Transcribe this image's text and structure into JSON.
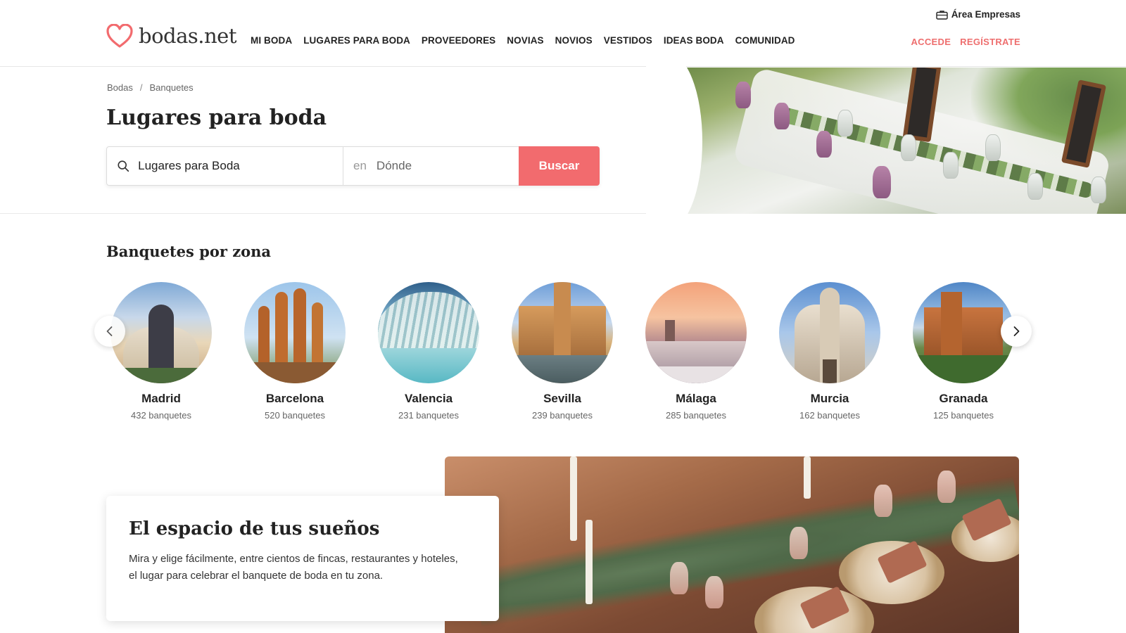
{
  "header": {
    "logo_text": "bodas.net",
    "area_empresas": "Área Empresas",
    "nav": [
      "MI BODA",
      "LUGARES PARA BODA",
      "PROVEEDORES",
      "NOVIAS",
      "NOVIOS",
      "VESTIDOS",
      "IDEAS BODA",
      "COMUNIDAD"
    ],
    "login": "ACCEDE",
    "register": "REGÍSTRATE"
  },
  "hero": {
    "breadcrumb": [
      "Bodas",
      "Banquetes"
    ],
    "breadcrumb_separator": "/",
    "title": "Lugares para boda",
    "search": {
      "what_value": "Lugares para Boda",
      "where_prefix": "en",
      "where_placeholder": "Dónde",
      "button": "Buscar"
    }
  },
  "zones": {
    "title": "Banquetes por zona",
    "items": [
      {
        "name": "Madrid",
        "count": "432 banquetes"
      },
      {
        "name": "Barcelona",
        "count": "520 banquetes"
      },
      {
        "name": "Valencia",
        "count": "231 banquetes"
      },
      {
        "name": "Sevilla",
        "count": "239 banquetes"
      },
      {
        "name": "Málaga",
        "count": "285 banquetes"
      },
      {
        "name": "Murcia",
        "count": "162 banquetes"
      },
      {
        "name": "Granada",
        "count": "125 banquetes"
      }
    ]
  },
  "promo": {
    "title": "El espacio de tus sueños",
    "text_line1": "Mira y elige fácilmente, entre cientos de fincas, restaurantes y hoteles,",
    "text_line2": "el lugar para celebrar el banquete de boda en tu zona."
  },
  "colors": {
    "brand": "#f26b6e",
    "auth_links": "#ee6e6e",
    "text": "#222222"
  }
}
